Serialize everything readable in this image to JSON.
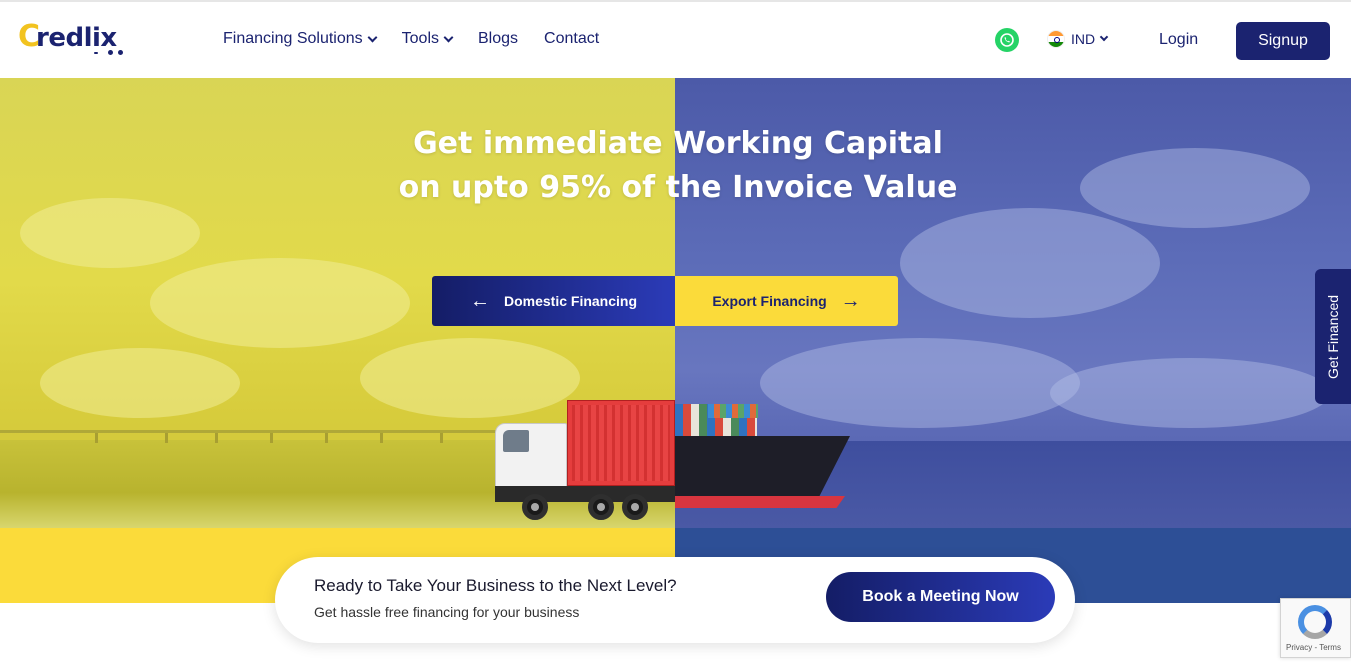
{
  "brand": {
    "logo_first": "C",
    "logo_rest": "redlix"
  },
  "nav": {
    "items": [
      {
        "label": "Financing Solutions",
        "has_dropdown": true
      },
      {
        "label": "Tools",
        "has_dropdown": true
      },
      {
        "label": "Blogs",
        "has_dropdown": false
      },
      {
        "label": "Contact",
        "has_dropdown": false
      }
    ]
  },
  "header": {
    "whatsapp_icon": "whatsapp-icon",
    "country": "IND",
    "login_label": "Login",
    "signup_label": "Signup"
  },
  "hero": {
    "title_line1": "Get immediate Working Capital",
    "title_line2": "on upto 95% of the Invoice Value",
    "domestic_label": "Domestic Financing",
    "export_label": "Export Financing"
  },
  "side_tab": {
    "label": "Get Financed"
  },
  "cta": {
    "title": "Ready to Take Your Business to the Next Level?",
    "subtitle": "Get hassle free financing for your business",
    "button_label": "Book a Meeting Now"
  },
  "recaptcha": {
    "text": "Privacy - Terms"
  },
  "colors": {
    "brand_navy": "#1b2370",
    "brand_yellow": "#fbdb3a",
    "whatsapp_green": "#25d366"
  }
}
